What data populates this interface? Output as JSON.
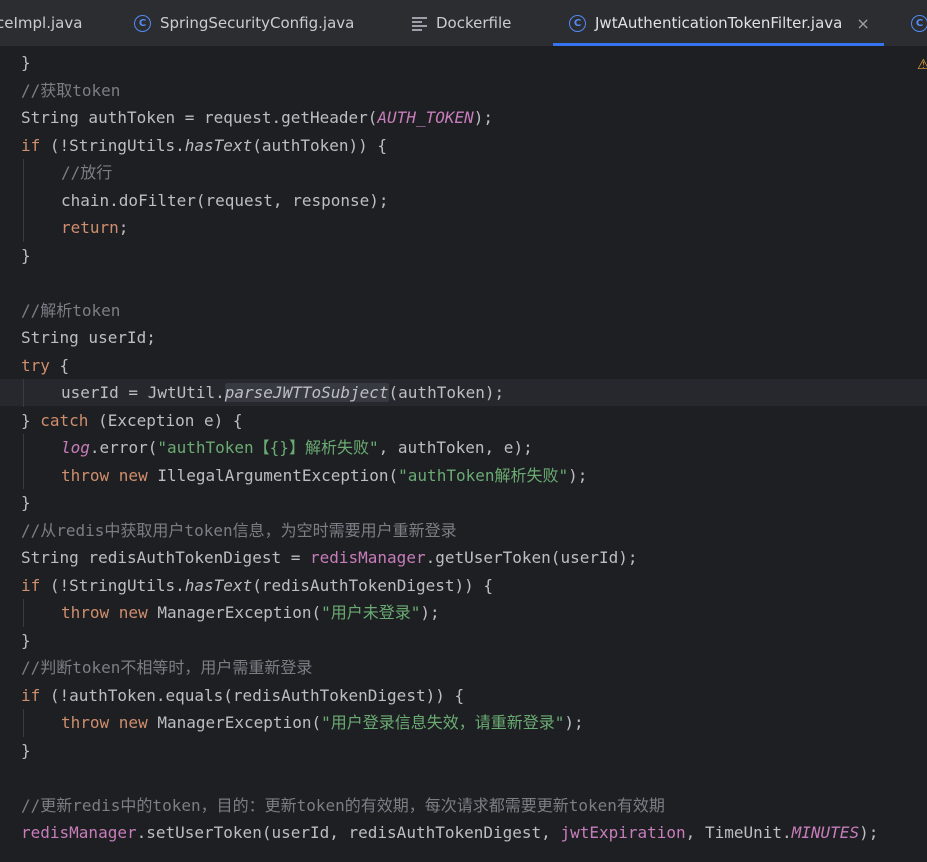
{
  "tabs": [
    {
      "label": "ceImpl.java",
      "icon": "java-class-icon",
      "active": false
    },
    {
      "label": "SpringSecurityConfig.java",
      "icon": "java-class-icon",
      "active": false
    },
    {
      "label": "Dockerfile",
      "icon": "text-file-icon",
      "active": false
    },
    {
      "label": "JwtAuthenticationTokenFilter.java",
      "icon": "java-class-icon",
      "active": true
    }
  ],
  "tab_close_glyph": "×",
  "class_icon_glyph": "C",
  "warning_glyph": "⚠",
  "colors": {
    "background": "#1e1f22",
    "tabbar": "#2b2d30",
    "active_tab_underline": "#3574f0",
    "keyword": "#cf8e6d",
    "string": "#6aab73",
    "comment": "#7a7e85",
    "field": "#c77dbb",
    "text": "#bcbec4",
    "warning": "#e8a33d"
  },
  "code": {
    "lines": [
      {
        "indent": 0,
        "tokens": [
          {
            "t": "}",
            "c": "plain"
          }
        ]
      },
      {
        "indent": 0,
        "tokens": [
          {
            "t": "//获取token",
            "c": "comment"
          }
        ]
      },
      {
        "indent": 0,
        "tokens": [
          {
            "t": "String authToken = request.getHeader(",
            "c": "plain"
          },
          {
            "t": "AUTH_TOKEN",
            "c": "field-italic"
          },
          {
            "t": ");",
            "c": "plain"
          }
        ]
      },
      {
        "indent": 0,
        "tokens": [
          {
            "t": "if",
            "c": "keyword"
          },
          {
            "t": " (!StringUtils.",
            "c": "plain"
          },
          {
            "t": "hasText",
            "c": "method-italic"
          },
          {
            "t": "(authToken)) {",
            "c": "plain"
          }
        ]
      },
      {
        "indent": 1,
        "tokens": [
          {
            "t": "//放行",
            "c": "comment"
          }
        ]
      },
      {
        "indent": 1,
        "tokens": [
          {
            "t": "chain.doFilter(request, response);",
            "c": "plain"
          }
        ]
      },
      {
        "indent": 1,
        "tokens": [
          {
            "t": "return",
            "c": "keyword"
          },
          {
            "t": ";",
            "c": "plain"
          }
        ]
      },
      {
        "indent": 0,
        "tokens": [
          {
            "t": "}",
            "c": "plain"
          }
        ]
      },
      {
        "indent": 0,
        "tokens": []
      },
      {
        "indent": 0,
        "tokens": [
          {
            "t": "//解析token",
            "c": "comment"
          }
        ]
      },
      {
        "indent": 0,
        "tokens": [
          {
            "t": "String userId;",
            "c": "plain"
          }
        ]
      },
      {
        "indent": 0,
        "tokens": [
          {
            "t": "try",
            "c": "keyword"
          },
          {
            "t": " {",
            "c": "plain"
          }
        ]
      },
      {
        "indent": 1,
        "current": true,
        "tokens": [
          {
            "t": "userId = JwtUtil.",
            "c": "plain"
          },
          {
            "t": "parseJWTToSubject",
            "c": "method-italic-hl"
          },
          {
            "t": "(authToken);",
            "c": "plain"
          }
        ]
      },
      {
        "indent": 0,
        "tokens": [
          {
            "t": "} ",
            "c": "plain"
          },
          {
            "t": "catch",
            "c": "keyword"
          },
          {
            "t": " (Exception e) {",
            "c": "plain"
          }
        ]
      },
      {
        "indent": 1,
        "tokens": [
          {
            "t": "log",
            "c": "field-italic"
          },
          {
            "t": ".error(",
            "c": "plain"
          },
          {
            "t": "\"authToken【{}】解析失败\"",
            "c": "string"
          },
          {
            "t": ", authToken, e);",
            "c": "plain"
          }
        ]
      },
      {
        "indent": 1,
        "tokens": [
          {
            "t": "throw new",
            "c": "keyword"
          },
          {
            "t": " IllegalArgumentException(",
            "c": "plain"
          },
          {
            "t": "\"authToken解析失败\"",
            "c": "string"
          },
          {
            "t": ");",
            "c": "plain"
          }
        ]
      },
      {
        "indent": 0,
        "tokens": [
          {
            "t": "}",
            "c": "plain"
          }
        ]
      },
      {
        "indent": 0,
        "tokens": [
          {
            "t": "//从redis中获取用户token信息，为空时需要用户重新登录",
            "c": "comment"
          }
        ]
      },
      {
        "indent": 0,
        "tokens": [
          {
            "t": "String redisAuthTokenDigest = ",
            "c": "plain"
          },
          {
            "t": "redisManager",
            "c": "field"
          },
          {
            "t": ".getUserToken(userId);",
            "c": "plain"
          }
        ]
      },
      {
        "indent": 0,
        "tokens": [
          {
            "t": "if",
            "c": "keyword"
          },
          {
            "t": " (!StringUtils.",
            "c": "plain"
          },
          {
            "t": "hasText",
            "c": "method-italic"
          },
          {
            "t": "(redisAuthTokenDigest)) {",
            "c": "plain"
          }
        ]
      },
      {
        "indent": 1,
        "tokens": [
          {
            "t": "throw new",
            "c": "keyword"
          },
          {
            "t": " ManagerException(",
            "c": "plain"
          },
          {
            "t": "\"用户未登录\"",
            "c": "string"
          },
          {
            "t": ");",
            "c": "plain"
          }
        ]
      },
      {
        "indent": 0,
        "tokens": [
          {
            "t": "}",
            "c": "plain"
          }
        ]
      },
      {
        "indent": 0,
        "tokens": [
          {
            "t": "//判断token不相等时，用户需重新登录",
            "c": "comment"
          }
        ]
      },
      {
        "indent": 0,
        "tokens": [
          {
            "t": "if",
            "c": "keyword"
          },
          {
            "t": " (!authToken.equals(redisAuthTokenDigest)) {",
            "c": "plain"
          }
        ]
      },
      {
        "indent": 1,
        "tokens": [
          {
            "t": "throw new",
            "c": "keyword"
          },
          {
            "t": " ManagerException(",
            "c": "plain"
          },
          {
            "t": "\"用户登录信息失效，请重新登录\"",
            "c": "string"
          },
          {
            "t": ");",
            "c": "plain"
          }
        ]
      },
      {
        "indent": 0,
        "tokens": [
          {
            "t": "}",
            "c": "plain"
          }
        ]
      },
      {
        "indent": 0,
        "tokens": []
      },
      {
        "indent": 0,
        "tokens": [
          {
            "t": "//更新redis中的token，目的：更新token的有效期，每次请求都需要更新token有效期",
            "c": "comment"
          }
        ]
      },
      {
        "indent": 0,
        "tokens": [
          {
            "t": "redisManager",
            "c": "field"
          },
          {
            "t": ".setUserToken(userId, redisAuthTokenDigest, ",
            "c": "plain"
          },
          {
            "t": "jwtExpiration",
            "c": "field"
          },
          {
            "t": ", TimeUnit.",
            "c": "plain"
          },
          {
            "t": "MINUTES",
            "c": "field-italic"
          },
          {
            "t": ");",
            "c": "plain"
          }
        ]
      }
    ]
  }
}
